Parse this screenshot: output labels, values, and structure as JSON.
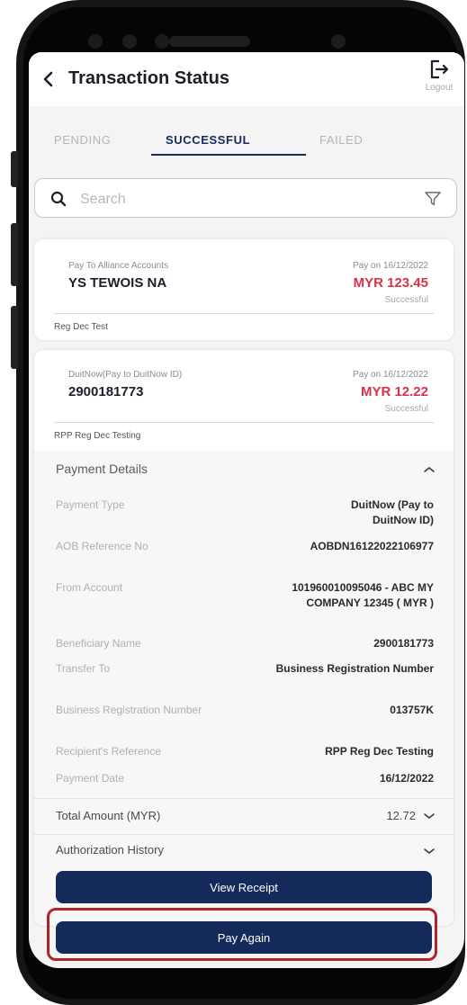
{
  "header": {
    "title": "Transaction Status",
    "logout_label": "Logout"
  },
  "tabs": [
    {
      "label": "PENDING",
      "active": false
    },
    {
      "label": "SUCCESSFUL",
      "active": true
    },
    {
      "label": "FAILED",
      "active": false
    }
  ],
  "search": {
    "placeholder": "Search"
  },
  "transactions": [
    {
      "type": "Pay To Alliance Accounts",
      "name": "YS TEWOIS NA",
      "date": "Pay on 16/12/2022",
      "amount": "MYR 123.45",
      "status": "Successful",
      "note": "Reg Dec Test"
    },
    {
      "type": "DuitNow(Pay to DuitNow ID)",
      "name": "2900181773",
      "date": "Pay on 16/12/2022",
      "amount": "MYR 12.22",
      "status": "Successful",
      "note": "RPP Reg Dec Testing"
    }
  ],
  "payment_details": {
    "title": "Payment Details",
    "rows": [
      {
        "label": "Payment Type",
        "value": "DuitNow (Pay to DuitNow ID)"
      },
      {
        "label": "AOB Reference No",
        "value": "AOBDN16122022106977"
      },
      {
        "label": "From Account",
        "value": "101960010095046 - ABC MY COMPANY 12345 ( MYR )"
      },
      {
        "label": "Beneficiary Name",
        "value": "2900181773"
      },
      {
        "label": "Transfer To",
        "value": "Business Registration Number"
      },
      {
        "label": "Business Registration Number",
        "value": "013757K"
      },
      {
        "label": "Recipient's Reference",
        "value": "RPP Reg Dec Testing"
      },
      {
        "label": "Payment Date",
        "value": "16/12/2022"
      }
    ],
    "total_label": "Total Amount (MYR)",
    "total_value": "12.72",
    "auth_label": "Authorization History"
  },
  "buttons": {
    "view_receipt": "View Receipt",
    "pay_again": "Pay Again"
  },
  "colors": {
    "primary": "#142a5b",
    "amount": "#d9314a",
    "highlight": "#b3232c"
  }
}
